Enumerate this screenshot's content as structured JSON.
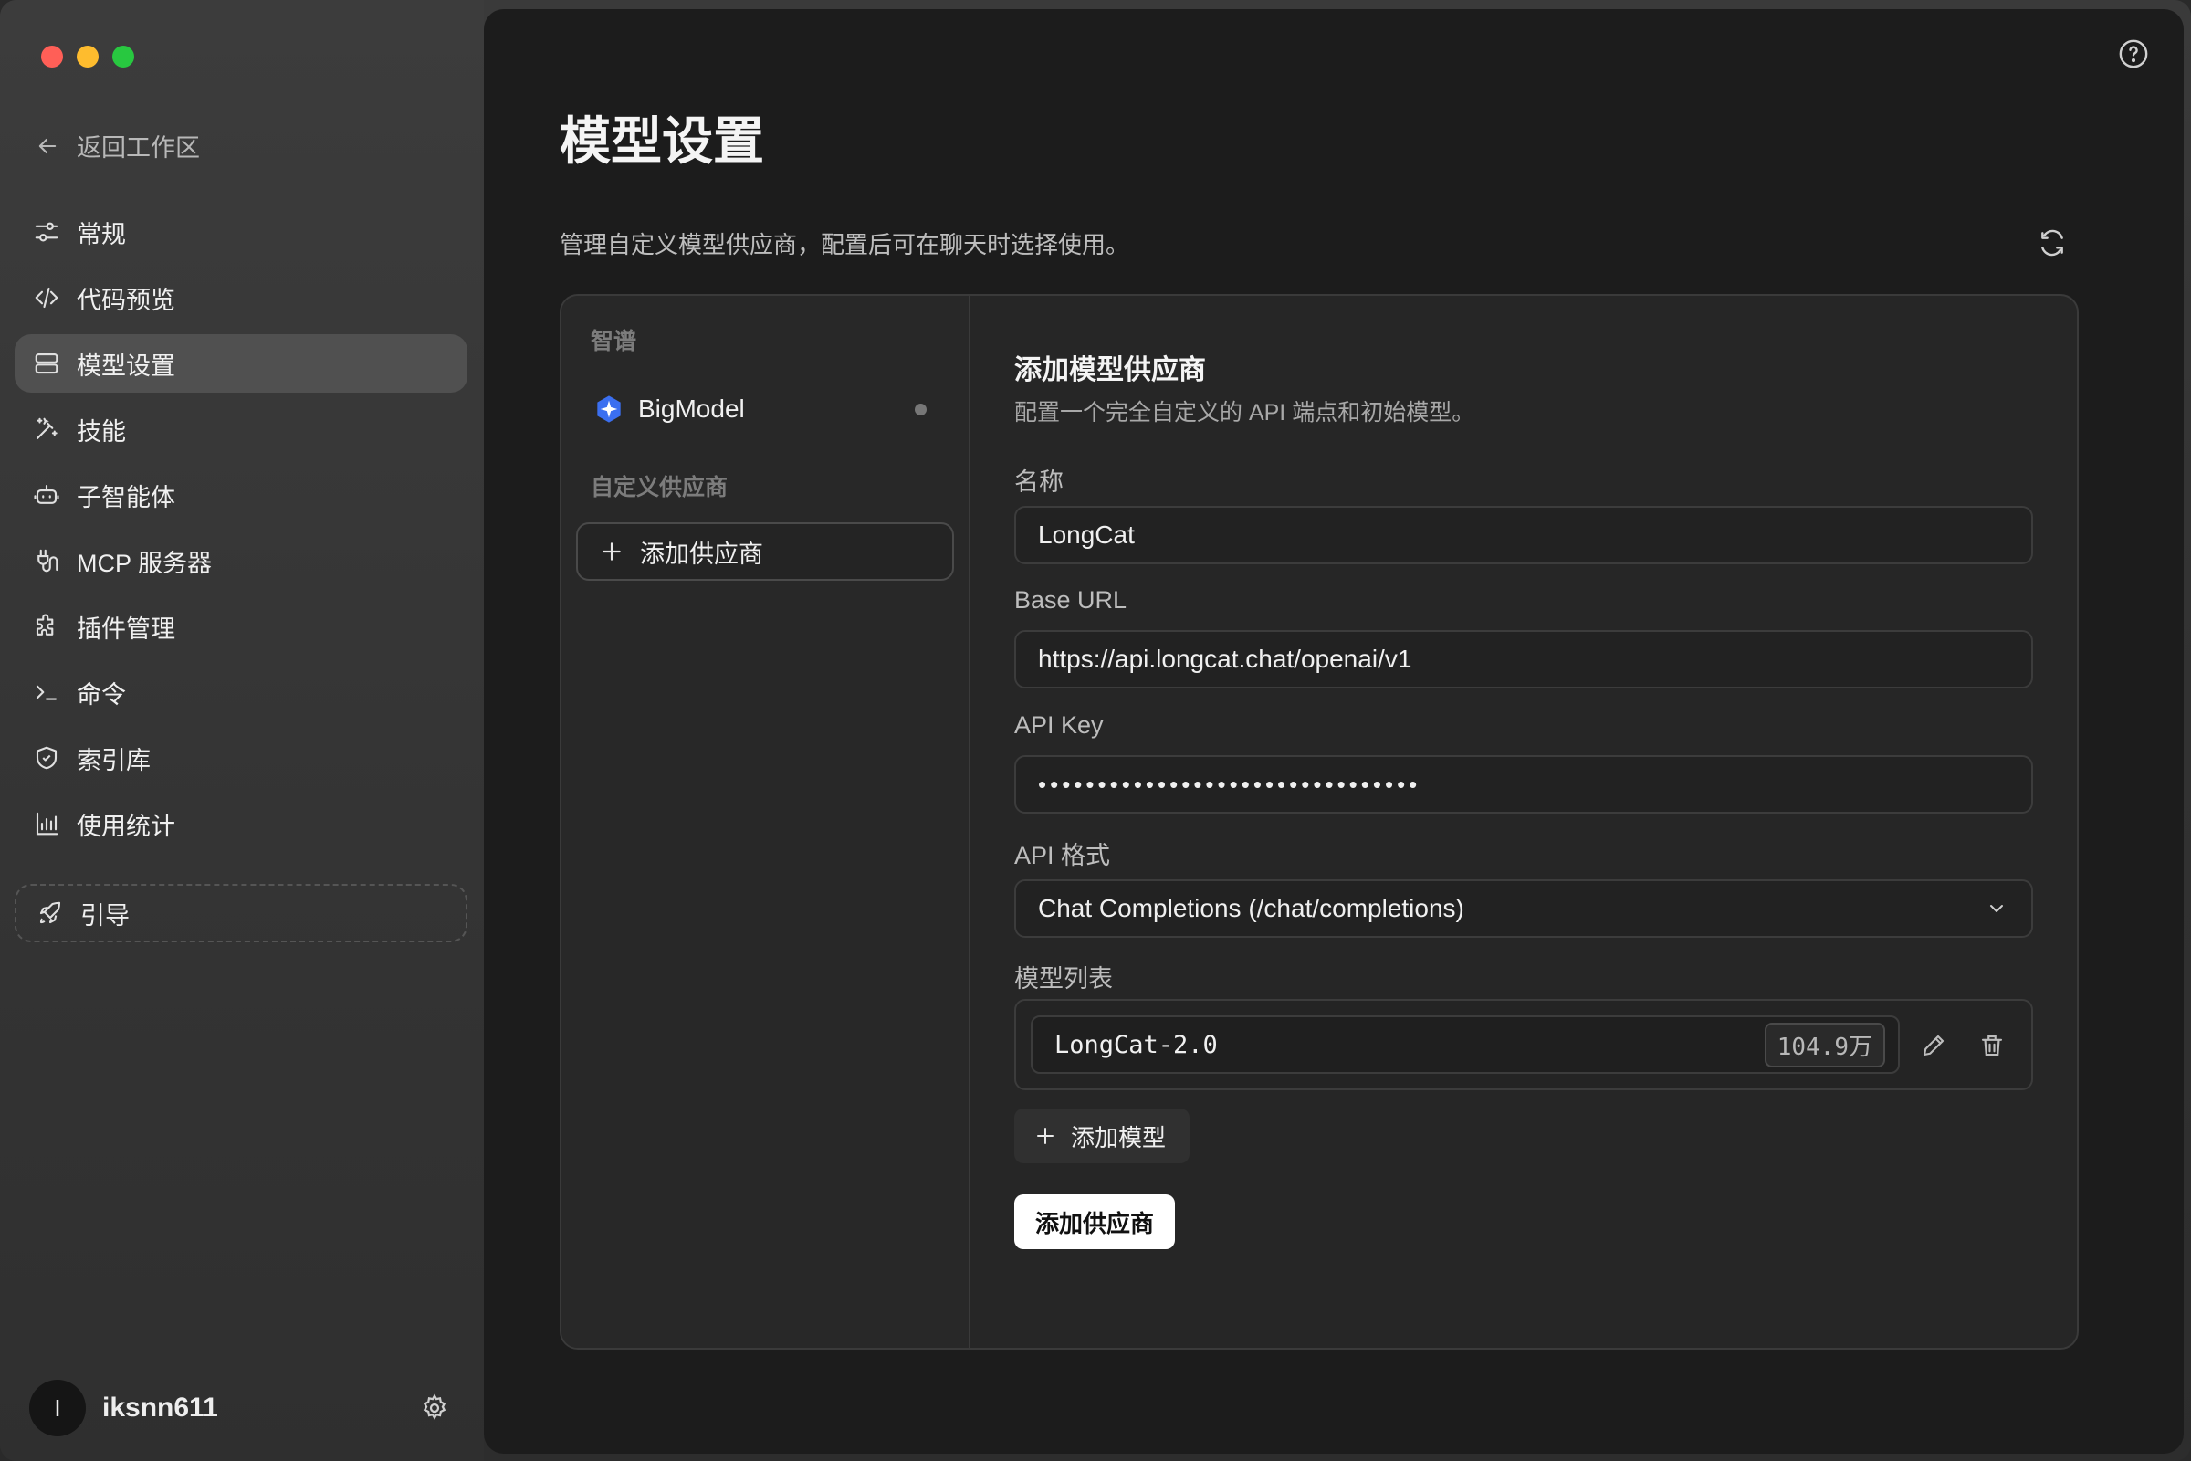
{
  "sidebar": {
    "back_label": "返回工作区",
    "items": [
      {
        "label": "常规",
        "icon": "sliders-icon"
      },
      {
        "label": "代码预览",
        "icon": "code-icon"
      },
      {
        "label": "模型设置",
        "icon": "server-icon"
      },
      {
        "label": "技能",
        "icon": "magic-wand-icon"
      },
      {
        "label": "子智能体",
        "icon": "robot-icon"
      },
      {
        "label": "MCP 服务器",
        "icon": "plug-icon"
      },
      {
        "label": "插件管理",
        "icon": "puzzle-icon"
      },
      {
        "label": "命令",
        "icon": "terminal-icon"
      },
      {
        "label": "索引库",
        "icon": "shield-icon"
      },
      {
        "label": "使用统计",
        "icon": "bar-chart-icon"
      }
    ],
    "active_item": "模型设置",
    "guide_label": "引导",
    "user": {
      "avatar_initial": "I",
      "name": "iksnn611"
    }
  },
  "main": {
    "title": "模型设置",
    "description": "管理自定义模型供应商，配置后可在聊天时选择使用。"
  },
  "providers": {
    "section_builtin": "智谱",
    "builtin_item": "BigModel",
    "section_custom": "自定义供应商",
    "add_provider_label": "添加供应商"
  },
  "form": {
    "title": "添加模型供应商",
    "description": "配置一个完全自定义的 API 端点和初始模型。",
    "name_label": "名称",
    "name_value": "LongCat",
    "base_url_label": "Base URL",
    "base_url_value": "https://api.longcat.chat/openai/v1",
    "api_key_label": "API Key",
    "api_key_value": "••••••••••••••••••••••••••••••••",
    "api_format_label": "API 格式",
    "api_format_value": "Chat Completions (/chat/completions)",
    "model_list_label": "模型列表",
    "models": [
      {
        "name": "LongCat-2.0",
        "context": "104.9万"
      }
    ],
    "add_model_label": "添加模型",
    "submit_label": "添加供应商"
  },
  "colors": {
    "active_nav_bg": "#505050",
    "main_bg": "#1c1c1c",
    "submit_bg": "#ffffff",
    "traffic_red": "#ff5f57",
    "traffic_yellow": "#febc2e",
    "traffic_green": "#28c840"
  }
}
